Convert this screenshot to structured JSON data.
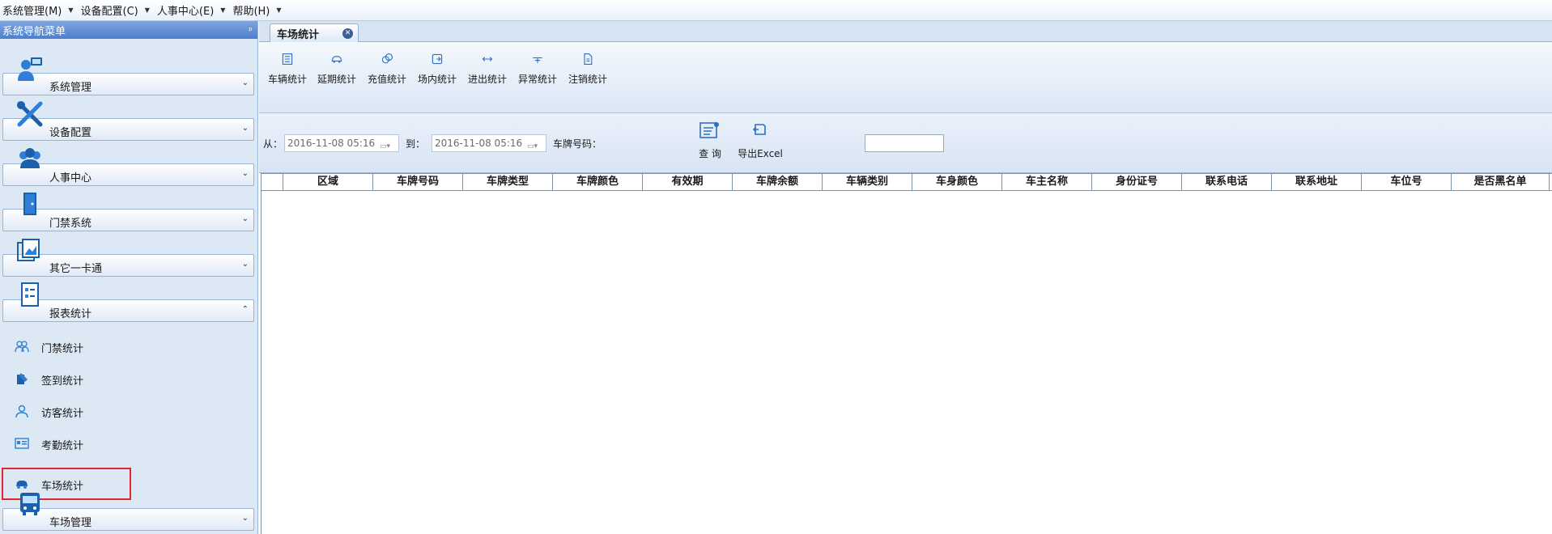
{
  "menubar": {
    "items": [
      {
        "label": "系统管理(M)"
      },
      {
        "label": "设备配置(C)"
      },
      {
        "label": "人事中心(E)"
      },
      {
        "label": "帮助(H)"
      }
    ]
  },
  "sidebar": {
    "title": "系统导航菜单",
    "sections": [
      {
        "label": "系统管理",
        "icon": "system-admin-icon",
        "expanded": false
      },
      {
        "label": "设备配置",
        "icon": "tools-icon",
        "expanded": false
      },
      {
        "label": "人事中心",
        "icon": "people-icon",
        "expanded": false
      },
      {
        "label": "门禁系统",
        "icon": "door-icon",
        "expanded": false
      },
      {
        "label": "其它一卡通",
        "icon": "cards-icon",
        "expanded": false
      },
      {
        "label": "报表统计",
        "icon": "report-icon",
        "expanded": true
      },
      {
        "label": "车场管理",
        "icon": "bus-icon",
        "expanded": false
      }
    ],
    "report_items": [
      {
        "label": "门禁统计",
        "icon": "users-icon"
      },
      {
        "label": "签到统计",
        "icon": "checkin-icon"
      },
      {
        "label": "访客统计",
        "icon": "visitor-icon"
      },
      {
        "label": "考勤统计",
        "icon": "attendance-icon"
      },
      {
        "label": "车场统计",
        "icon": "car-icon",
        "selected": true
      }
    ]
  },
  "tabs": [
    {
      "label": "车场统计",
      "active": true
    }
  ],
  "ribbon": {
    "buttons": [
      {
        "label": "车辆统计",
        "icon": "list-icon"
      },
      {
        "label": "延期统计",
        "icon": "car-extend-icon"
      },
      {
        "label": "充值统计",
        "icon": "recharge-icon"
      },
      {
        "label": "场内统计",
        "icon": "inside-icon"
      },
      {
        "label": "进出统计",
        "icon": "in-out-arrows-icon"
      },
      {
        "label": "异常统计",
        "icon": "abnormal-icon"
      },
      {
        "label": "注销统计",
        "icon": "cancel-doc-icon"
      }
    ]
  },
  "filter": {
    "from_label": "从：",
    "from_value": "2016-11-08 05:16",
    "to_label": "到：",
    "to_value": "2016-11-08 05:16",
    "plate_label": "车牌号码：",
    "plate_value": "",
    "query_label": "查 询",
    "export_label": "导出Excel"
  },
  "table": {
    "columns": [
      "",
      "区域",
      "车牌号码",
      "车牌类型",
      "车牌颜色",
      "有效期",
      "车牌余额",
      "车辆类别",
      "车身颜色",
      "车主名称",
      "身份证号",
      "联系电话",
      "联系地址",
      "车位号",
      "是否黑名单"
    ],
    "rows": []
  },
  "colors": {
    "accent": "#3a73c7",
    "selection_border": "#e0282c",
    "sidebar_bg": "#dde8f5"
  }
}
